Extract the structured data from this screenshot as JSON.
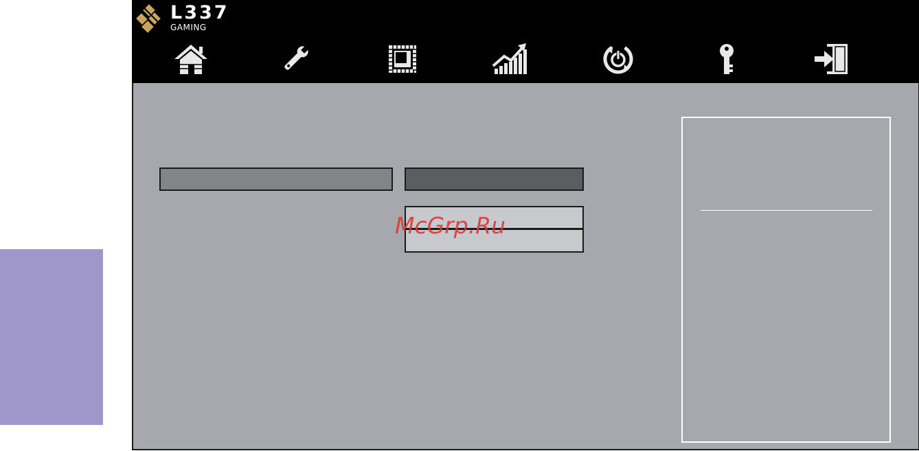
{
  "brand": {
    "name": "L337",
    "subtitle": "GAMING",
    "logo_color": "#c9a45c"
  },
  "nav": {
    "items": [
      {
        "icon": "home-icon"
      },
      {
        "icon": "wrench-icon"
      },
      {
        "icon": "cpu-chip-icon"
      },
      {
        "icon": "performance-chart-icon"
      },
      {
        "icon": "power-cycle-icon"
      },
      {
        "icon": "key-icon"
      },
      {
        "icon": "exit-door-icon"
      }
    ],
    "icon_color": "#e8e8e8"
  },
  "watermark": {
    "text": "McGrp.Ru"
  },
  "colors": {
    "header_bg": "#000000",
    "panel_bg": "#a7a8ad",
    "side_tab": "#9f97cb",
    "watermark": "#d93a3a"
  }
}
